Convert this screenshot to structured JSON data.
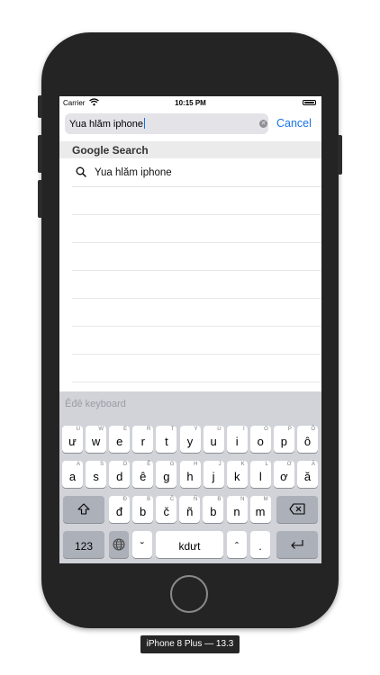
{
  "status": {
    "carrier": "Carrier",
    "time": "10:15 PM"
  },
  "search": {
    "value": "Yua hlăm iphone",
    "cancel_label": "Cancel"
  },
  "suggestions": {
    "header": "Google Search",
    "items": [
      {
        "text": "Yua hlăm iphone"
      }
    ]
  },
  "keyboard": {
    "title": "Êđê keyboard",
    "row1": [
      {
        "key": "ư",
        "alt": "U"
      },
      {
        "key": "w",
        "alt": "W"
      },
      {
        "key": "e",
        "alt": "E"
      },
      {
        "key": "r",
        "alt": "R"
      },
      {
        "key": "t",
        "alt": "T"
      },
      {
        "key": "y",
        "alt": "Y"
      },
      {
        "key": "u",
        "alt": "U"
      },
      {
        "key": "i",
        "alt": "I"
      },
      {
        "key": "o",
        "alt": "O"
      },
      {
        "key": "p",
        "alt": "P"
      },
      {
        "key": "ô",
        "alt": "Ô"
      }
    ],
    "row2": [
      {
        "key": "a",
        "alt": "A"
      },
      {
        "key": "s",
        "alt": "S"
      },
      {
        "key": "d",
        "alt": "D"
      },
      {
        "key": "ê",
        "alt": "Ê"
      },
      {
        "key": "g",
        "alt": "G"
      },
      {
        "key": "h",
        "alt": "H"
      },
      {
        "key": "j",
        "alt": "J"
      },
      {
        "key": "k",
        "alt": "K"
      },
      {
        "key": "l",
        "alt": "L"
      },
      {
        "key": "ơ",
        "alt": "Ơ"
      },
      {
        "key": "ă",
        "alt": "Ă"
      }
    ],
    "row3": [
      {
        "key": "đ",
        "alt": "Đ"
      },
      {
        "key": "b",
        "alt": "B"
      },
      {
        "key": "č",
        "alt": "Č"
      },
      {
        "key": "ñ",
        "alt": "Ñ"
      },
      {
        "key": "b",
        "alt": "B"
      },
      {
        "key": "n",
        "alt": "N"
      },
      {
        "key": "m",
        "alt": "M"
      }
    ],
    "numbers_label": "123",
    "breve_label": "˘",
    "space_label": "kdưt",
    "circumflex_label": "ˆ",
    "period_label": "."
  },
  "device_label": "iPhone 8 Plus — 13.3"
}
